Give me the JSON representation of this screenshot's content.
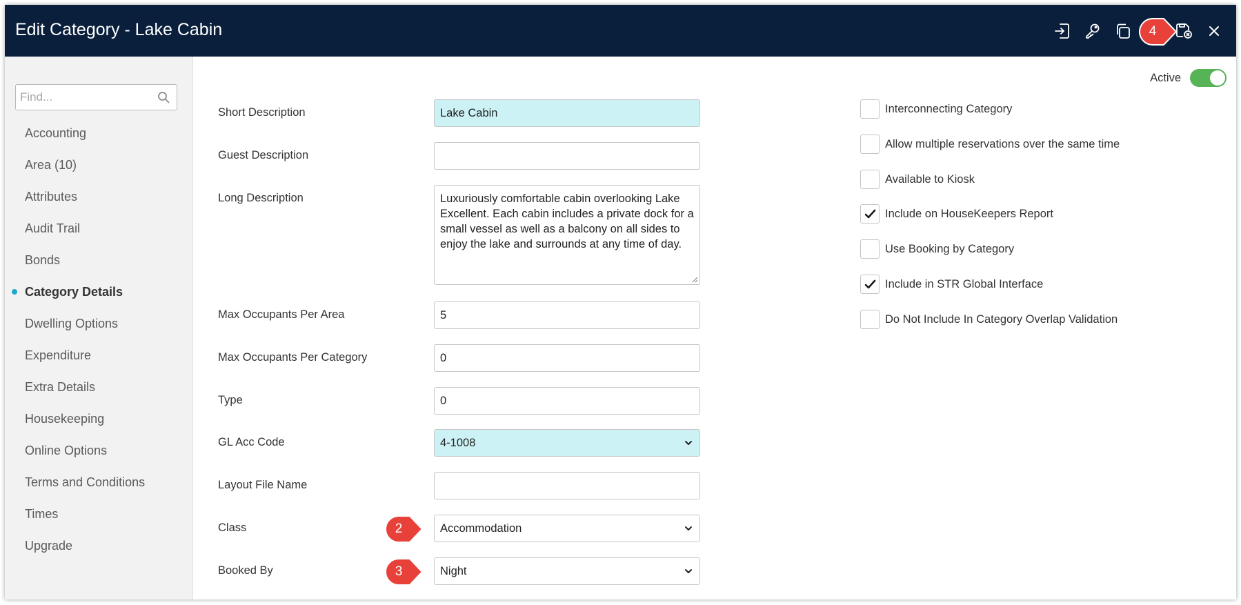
{
  "header": {
    "title": "Edit Category - Lake Cabin",
    "icons": [
      "sign-in-icon",
      "key-icon",
      "copy-icon",
      "save-icon",
      "save-close-icon",
      "close-icon"
    ],
    "step_badge": "4"
  },
  "sidebar": {
    "find_placeholder": "Find...",
    "items": [
      {
        "label": "Accounting"
      },
      {
        "label": "Area (10)"
      },
      {
        "label": "Attributes"
      },
      {
        "label": "Audit Trail"
      },
      {
        "label": "Bonds"
      },
      {
        "label": "Category Details",
        "active": true
      },
      {
        "label": "Dwelling Options"
      },
      {
        "label": "Expenditure"
      },
      {
        "label": "Extra Details"
      },
      {
        "label": "Housekeeping"
      },
      {
        "label": "Online Options"
      },
      {
        "label": "Terms and Conditions"
      },
      {
        "label": "Times"
      },
      {
        "label": "Upgrade"
      }
    ]
  },
  "form": {
    "short_description": {
      "label": "Short Description",
      "value": "Lake Cabin"
    },
    "guest_description": {
      "label": "Guest Description",
      "value": ""
    },
    "long_description": {
      "label": "Long Description",
      "value": "Luxuriously comfortable cabin overlooking Lake Excellent. Each cabin includes a private dock for a small vessel as well as a balcony on all sides to enjoy the lake and surrounds at any time of day."
    },
    "max_occupants_area": {
      "label": "Max Occupants Per Area",
      "value": "5"
    },
    "max_occupants_category": {
      "label": "Max Occupants Per Category",
      "value": "0"
    },
    "type": {
      "label": "Type",
      "value": "0"
    },
    "gl_acc_code": {
      "label": "GL Acc Code",
      "value": "4-1008"
    },
    "layout_file_name": {
      "label": "Layout File Name",
      "value": ""
    },
    "class": {
      "label": "Class",
      "value": "Accommodation",
      "badge": "2"
    },
    "booked_by": {
      "label": "Booked By",
      "value": "Night",
      "badge": "3"
    }
  },
  "active": {
    "label": "Active",
    "on": true
  },
  "options": [
    {
      "label": "Interconnecting Category",
      "checked": false
    },
    {
      "label": "Allow multiple reservations over the same time",
      "checked": false
    },
    {
      "label": "Available to Kiosk",
      "checked": false
    },
    {
      "label": "Include on HouseKeepers Report",
      "checked": true
    },
    {
      "label": "Use Booking by Category",
      "checked": false
    },
    {
      "label": "Include in STR Global Interface",
      "checked": true
    },
    {
      "label": "Do Not Include In Category Overlap Validation",
      "checked": false
    }
  ],
  "colors": {
    "header_bg": "#0a1f3c",
    "highlight_field": "#cdf2f6",
    "badge_red": "#e8413a",
    "toggle_on": "#56b356",
    "active_dot": "#1fa8c9"
  }
}
